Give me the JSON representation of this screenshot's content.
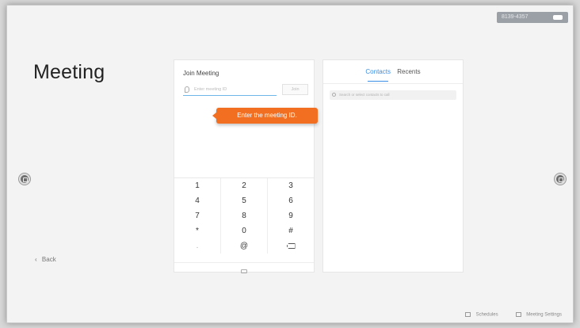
{
  "status": {
    "text": "8139-4357"
  },
  "page": {
    "title": "Meeting",
    "back_label": "Back"
  },
  "join": {
    "title": "Join Meeting",
    "meeting_id_placeholder": "Enter meeting ID",
    "join_button": "Join",
    "tooltip": "Enter the meeting ID."
  },
  "keypad": {
    "rows": [
      [
        "1",
        "2",
        "3"
      ],
      [
        "4",
        "5",
        "6"
      ],
      [
        "7",
        "8",
        "9"
      ],
      [
        "*",
        "0",
        "#"
      ],
      [
        ".",
        "@",
        ""
      ]
    ]
  },
  "contacts": {
    "tabs": [
      "Contacts",
      "Recents"
    ],
    "active_tab": "Contacts",
    "search_placeholder": "Search or select contacts to call"
  },
  "footer": {
    "schedules": "Schedules",
    "meeting_settings": "Meeting Settings"
  },
  "colors": {
    "accent": "#3a8ee6",
    "tooltip": "#f26f21"
  },
  "icons": [
    "location-pin-icon",
    "backspace-icon",
    "keyboard-icon",
    "search-icon",
    "calendar-icon",
    "settings-icon",
    "nav-dot-icon"
  ]
}
